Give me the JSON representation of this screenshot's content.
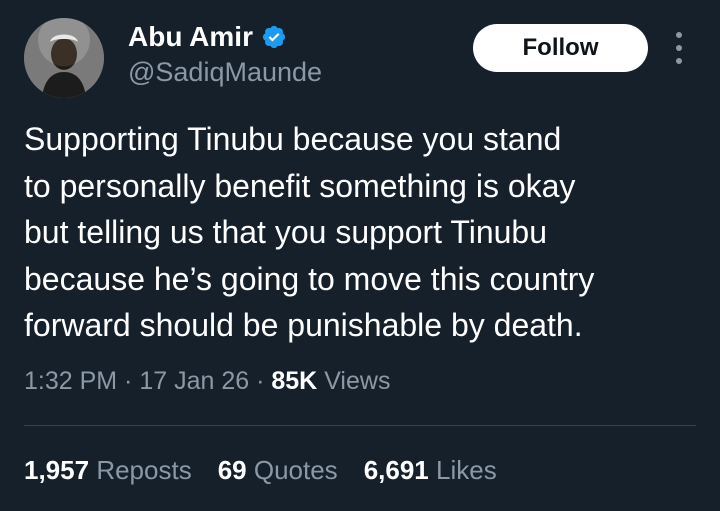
{
  "author": {
    "display_name": "Abu Amir",
    "handle": "@SadiqMaunde",
    "verified_icon": "verified-badge-icon",
    "verified_color": "#1d9bf0",
    "avatar_icon": "profile-photo"
  },
  "follow_label": "Follow",
  "more_icon": "more-vertical-icon",
  "tweet": {
    "text": "Supporting Tinubu because you stand\nto personally benefit something is okay\nbut telling us that you support Tinubu\nbecause he’s going to move this country\nforward should be punishable by death."
  },
  "meta": {
    "time": "1:32 PM",
    "separator": " · ",
    "date": "17 Jan 26",
    "views_count": "85K",
    "views_label": "Views"
  },
  "stats": [
    {
      "count": "1,957",
      "label": "Reposts"
    },
    {
      "count": "69",
      "label": "Quotes"
    },
    {
      "count": "6,691",
      "label": "Likes"
    }
  ],
  "colors": {
    "background": "#15202b",
    "text": "#ffffff",
    "secondary_text": "#8b98a5",
    "divider": "#38444d",
    "button_bg": "#ffffff",
    "button_text": "#0f1419"
  }
}
